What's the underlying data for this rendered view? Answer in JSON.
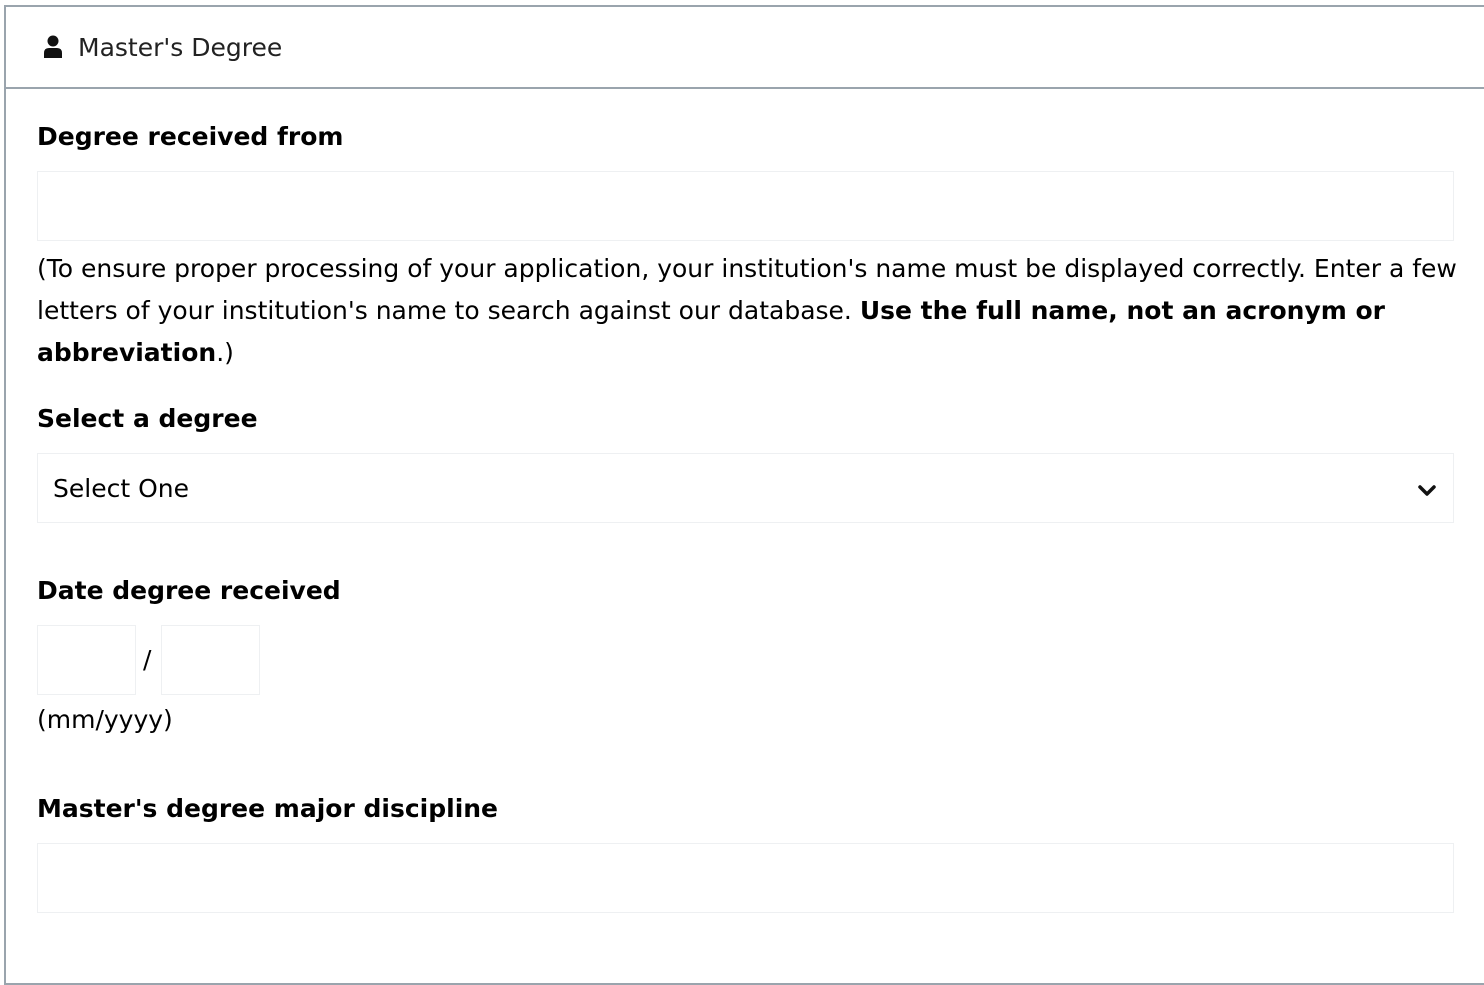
{
  "panel": {
    "title": "Master's Degree",
    "icon": "user-icon"
  },
  "fields": {
    "institution": {
      "label": "Degree received from",
      "value": "",
      "placeholder": ""
    },
    "help": {
      "text_plain": "(To ensure proper processing of your application, your institution's name must be displayed correctly. Enter a few letters of your institution's name to search against our database. ",
      "text_bold": "Use the full name, not an acronym or abbreviation",
      "text_end": ".)"
    },
    "degree": {
      "label": "Select a degree",
      "selected": "Select One"
    },
    "date": {
      "label": "Date degree received",
      "month": "",
      "year": "",
      "separator": "/",
      "format_hint": "(mm/yyyy)"
    },
    "major": {
      "label": "Master's degree major discipline",
      "value": "",
      "placeholder": ""
    }
  }
}
